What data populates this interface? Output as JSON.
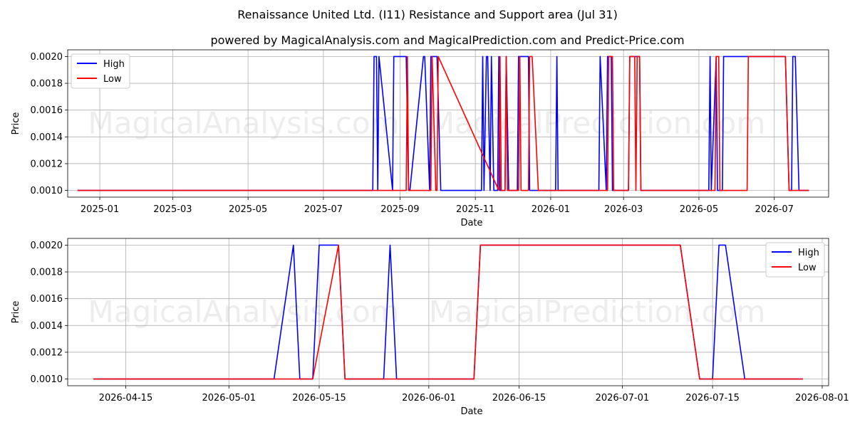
{
  "chart_title": "Renaissance United Ltd. (I11) Resistance and Support area (Jul 31)",
  "chart_subtitle": "powered by MagicalAnalysis.com and MagicalPrediction.com and Predict-Price.com",
  "watermarks": [
    "MagicalAnalysis.com",
    "MagicalPrediction.com"
  ],
  "colors": {
    "high": "#0000ff",
    "low": "#ff0000"
  },
  "chart_data": [
    {
      "type": "line",
      "xlabel": "Date",
      "ylabel": "Price",
      "legend_placement": "top-left",
      "grid": true,
      "xlim": [
        "2024-12-06",
        "2026-08-14"
      ],
      "ylim": [
        0.00095,
        0.00205
      ],
      "x_ticks": [
        "2025-01",
        "2025-03",
        "2025-05",
        "2025-07",
        "2025-09",
        "2025-11",
        "2026-01",
        "2026-03",
        "2026-05",
        "2026-07"
      ],
      "y_ticks": [
        "0.0010",
        "0.0012",
        "0.0014",
        "0.0016",
        "0.0018",
        "0.0020"
      ],
      "series": [
        {
          "name": "High",
          "x": [
            "2024-12-14",
            "2025-08-10",
            "2025-08-11",
            "2025-08-13",
            "2025-08-14",
            "2025-08-15",
            "2025-08-26",
            "2025-08-27",
            "2025-08-28",
            "2025-09-06",
            "2025-09-08",
            "2025-09-09",
            "2025-09-20",
            "2025-09-21",
            "2025-09-25",
            "2025-09-26",
            "2025-09-27",
            "2025-10-01",
            "2025-10-04",
            "2025-10-05",
            "2025-11-06",
            "2025-11-07",
            "2025-11-08",
            "2025-11-10",
            "2025-11-11",
            "2025-11-13",
            "2025-11-14",
            "2025-11-16",
            "2025-11-19",
            "2025-11-20",
            "2025-11-21",
            "2025-11-25",
            "2025-11-26",
            "2025-11-28",
            "2025-12-05",
            "2025-12-06",
            "2025-12-08",
            "2025-12-14",
            "2025-12-15",
            "2025-12-16",
            "2026-01-05",
            "2026-01-06",
            "2026-01-07",
            "2026-02-09",
            "2026-02-10",
            "2026-02-15",
            "2026-02-16",
            "2026-02-19",
            "2026-02-20",
            "2026-03-05",
            "2026-03-06",
            "2026-03-13",
            "2026-03-14",
            "2026-03-15",
            "2026-05-09",
            "2026-05-10",
            "2026-05-11",
            "2026-05-15",
            "2026-05-16",
            "2026-05-20",
            "2026-05-21",
            "2026-06-09",
            "2026-06-10",
            "2026-07-10",
            "2026-07-13",
            "2026-07-15",
            "2026-07-16",
            "2026-07-18",
            "2026-07-21",
            "2026-07-29"
          ],
          "values": [
            0.001,
            0.001,
            0.002,
            0.002,
            0.001,
            0.002,
            0.001,
            0.002,
            0.002,
            0.002,
            0.001,
            0.001,
            0.002,
            0.002,
            0.001,
            0.002,
            0.002,
            0.002,
            0.001,
            0.001,
            0.001,
            0.002,
            0.001,
            0.002,
            0.002,
            0.001,
            0.002,
            0.001,
            0.001,
            0.002,
            0.001,
            0.001,
            0.002,
            0.001,
            0.001,
            0.002,
            0.002,
            0.002,
            0.001,
            0.001,
            0.001,
            0.002,
            0.001,
            0.001,
            0.002,
            0.001,
            0.002,
            0.002,
            0.001,
            0.001,
            0.002,
            0.002,
            0.002,
            0.001,
            0.001,
            0.002,
            0.001,
            0.002,
            0.001,
            0.001,
            0.002,
            0.002,
            0.002,
            0.002,
            0.001,
            0.001,
            0.002,
            0.002,
            0.001,
            0.001
          ]
        },
        {
          "name": "Low",
          "x": [
            "2024-12-14",
            "2025-09-06",
            "2025-09-07",
            "2025-09-08",
            "2025-09-26",
            "2025-09-27",
            "2025-09-30",
            "2025-10-01",
            "2025-10-02",
            "2025-11-20",
            "2025-11-21",
            "2025-11-22",
            "2025-11-25",
            "2025-11-26",
            "2025-11-27",
            "2025-12-06",
            "2025-12-07",
            "2025-12-08",
            "2025-12-14",
            "2025-12-15",
            "2025-12-17",
            "2025-12-22",
            "2026-02-16",
            "2026-02-17",
            "2026-02-20",
            "2026-02-21",
            "2026-03-05",
            "2026-03-06",
            "2026-03-10",
            "2026-03-11",
            "2026-03-12",
            "2026-03-14",
            "2026-03-15",
            "2026-05-14",
            "2026-05-15",
            "2026-05-17",
            "2026-05-18",
            "2026-06-09",
            "2026-06-10",
            "2026-07-10",
            "2026-07-13",
            "2026-07-29"
          ],
          "values": [
            0.001,
            0.001,
            0.002,
            0.001,
            0.001,
            0.002,
            0.001,
            0.001,
            0.002,
            0.001,
            0.002,
            0.001,
            0.001,
            0.002,
            0.001,
            0.001,
            0.002,
            0.001,
            0.001,
            0.002,
            0.002,
            0.001,
            0.001,
            0.002,
            0.002,
            0.001,
            0.001,
            0.002,
            0.002,
            0.001,
            0.002,
            0.002,
            0.001,
            0.001,
            0.002,
            0.002,
            0.001,
            0.001,
            0.002,
            0.002,
            0.001,
            0.001
          ]
        }
      ]
    },
    {
      "type": "line",
      "xlabel": "Date",
      "ylabel": "Price",
      "legend_placement": "top-right",
      "grid": true,
      "xlim": [
        "2026-04-06",
        "2026-08-02"
      ],
      "ylim": [
        0.00095,
        0.00205
      ],
      "x_ticks": [
        "2026-04-15",
        "2026-05-01",
        "2026-05-15",
        "2026-06-01",
        "2026-06-15",
        "2026-07-01",
        "2026-07-15",
        "2026-08-01"
      ],
      "y_ticks": [
        "0.0010",
        "0.0012",
        "0.0014",
        "0.0016",
        "0.0018",
        "0.0020"
      ],
      "series": [
        {
          "name": "High",
          "x": [
            "2026-04-10",
            "2026-05-08",
            "2026-05-11",
            "2026-05-12",
            "2026-05-14",
            "2026-05-15",
            "2026-05-18",
            "2026-05-19",
            "2026-05-25",
            "2026-05-26",
            "2026-05-27",
            "2026-06-08",
            "2026-06-09",
            "2026-07-10",
            "2026-07-13",
            "2026-07-15",
            "2026-07-16",
            "2026-07-17",
            "2026-07-20",
            "2026-07-29"
          ],
          "values": [
            0.001,
            0.001,
            0.002,
            0.001,
            0.001,
            0.002,
            0.002,
            0.001,
            0.001,
            0.002,
            0.001,
            0.001,
            0.002,
            0.002,
            0.001,
            0.001,
            0.002,
            0.002,
            0.001,
            0.001
          ]
        },
        {
          "name": "Low",
          "x": [
            "2026-04-10",
            "2026-05-14",
            "2026-05-18",
            "2026-05-19",
            "2026-06-08",
            "2026-06-09",
            "2026-07-10",
            "2026-07-13",
            "2026-07-29"
          ],
          "values": [
            0.001,
            0.001,
            0.002,
            0.001,
            0.001,
            0.002,
            0.002,
            0.001,
            0.001
          ]
        }
      ]
    }
  ]
}
